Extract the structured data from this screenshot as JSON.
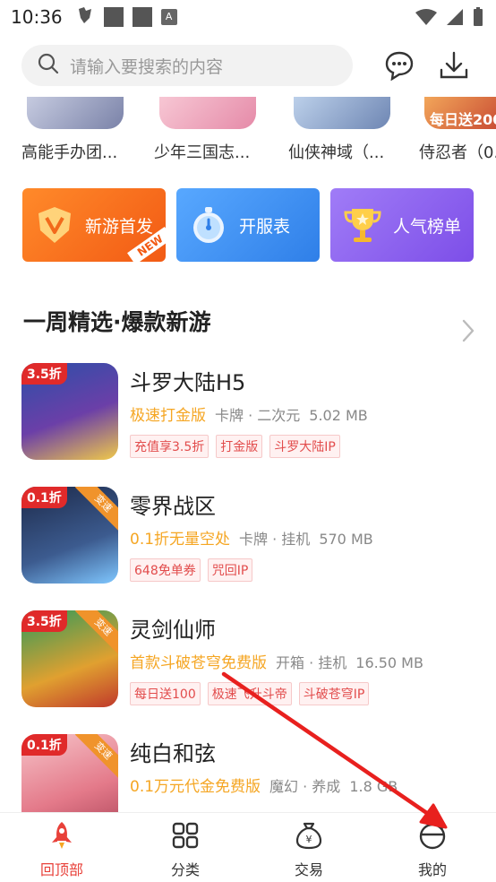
{
  "status_bar": {
    "time": "10:36",
    "icon_letter": "A"
  },
  "search": {
    "placeholder": "请输入要搜索的内容"
  },
  "top_games": [
    {
      "name": "高能手办团..."
    },
    {
      "name": "少年三国志..."
    },
    {
      "name": "仙侠神域（..."
    },
    {
      "name": "侍忍者（0."
    }
  ],
  "top_game_banner": "每日送200",
  "quick_actions": [
    {
      "label": "新游首发",
      "badge": "NEW",
      "color": "#f5731f"
    },
    {
      "label": "开服表",
      "color": "#3f8ff0"
    },
    {
      "label": "人气榜单",
      "color": "#8a5cf0"
    }
  ],
  "section": {
    "title": "一周精选·爆款新游"
  },
  "games": [
    {
      "title": "斗罗大陆H5",
      "version": "极速打金版",
      "category": "卡牌 · 二次元",
      "size": "5.02 MB",
      "discount": "3.5折",
      "tags": [
        "充值享3.5折",
        "打金版",
        "斗罗大陆IP"
      ]
    },
    {
      "title": "零界战区",
      "version": "0.1折无量空处",
      "category": "卡牌 · 挂机",
      "size": "570 MB",
      "discount": "0.1折",
      "corner": "变速",
      "tags": [
        "648免单券",
        "咒回IP"
      ]
    },
    {
      "title": "灵剑仙师",
      "version": "首款斗破苍穹免费版",
      "category": "开箱 · 挂机",
      "size": "16.50 MB",
      "discount": "3.5折",
      "corner": "变速",
      "tags": [
        "每日送100",
        "极速飞升斗帝",
        "斗破苍穹IP"
      ]
    },
    {
      "title": "纯白和弦",
      "version": "0.1万元代金免费版",
      "category": "魔幻 · 养成",
      "size": "1.8 GB",
      "discount": "0.1折",
      "corner": "变速",
      "tags": []
    }
  ],
  "bottom_nav": [
    {
      "label": "回顶部",
      "active": true
    },
    {
      "label": "分类"
    },
    {
      "label": "交易"
    },
    {
      "label": "我的"
    }
  ],
  "colors": {
    "accent": "#e8413a",
    "version_text": "#f5a623",
    "annotation_arrow": "#e8201e"
  }
}
